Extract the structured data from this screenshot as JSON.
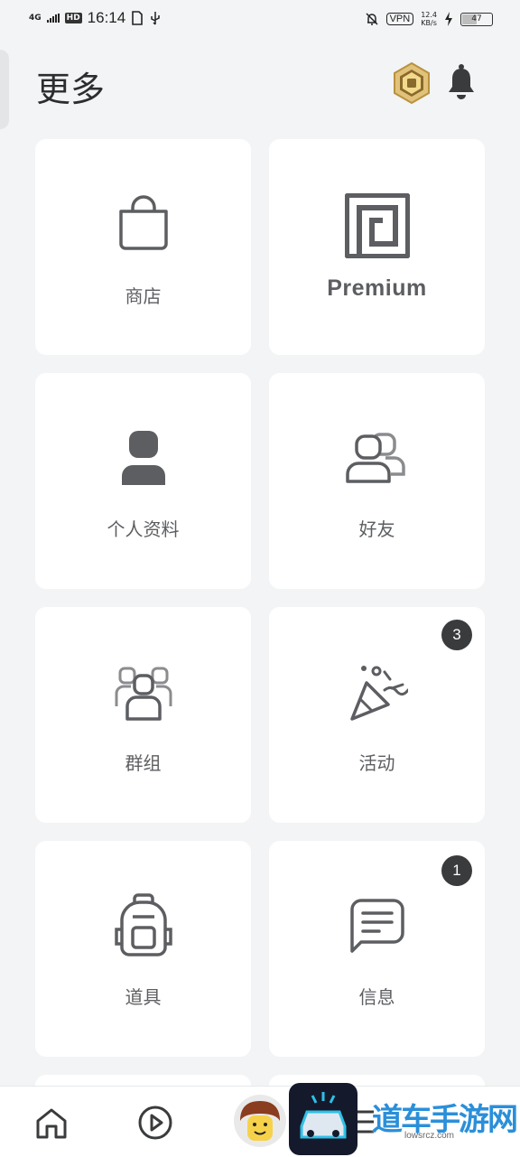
{
  "status_bar": {
    "network": "4G",
    "hd": "HD",
    "time": "16:14",
    "vpn": "VPN",
    "speed_value": "12.4",
    "speed_unit": "KB/s",
    "battery": "47"
  },
  "header": {
    "title": "更多"
  },
  "menu": {
    "shop": "商店",
    "premium": "Premium",
    "profile": "个人资料",
    "friends": "好友",
    "groups": "群组",
    "events": "活动",
    "events_badge": "3",
    "inventory": "道具",
    "messages": "信息",
    "messages_badge": "1"
  },
  "watermark": {
    "text": "道车手游网",
    "url": "lowsrcz.com"
  },
  "colors": {
    "background": "#f2f4f5",
    "card": "#ffffff",
    "icon": "#5c5e61",
    "badge": "#393b3d"
  }
}
